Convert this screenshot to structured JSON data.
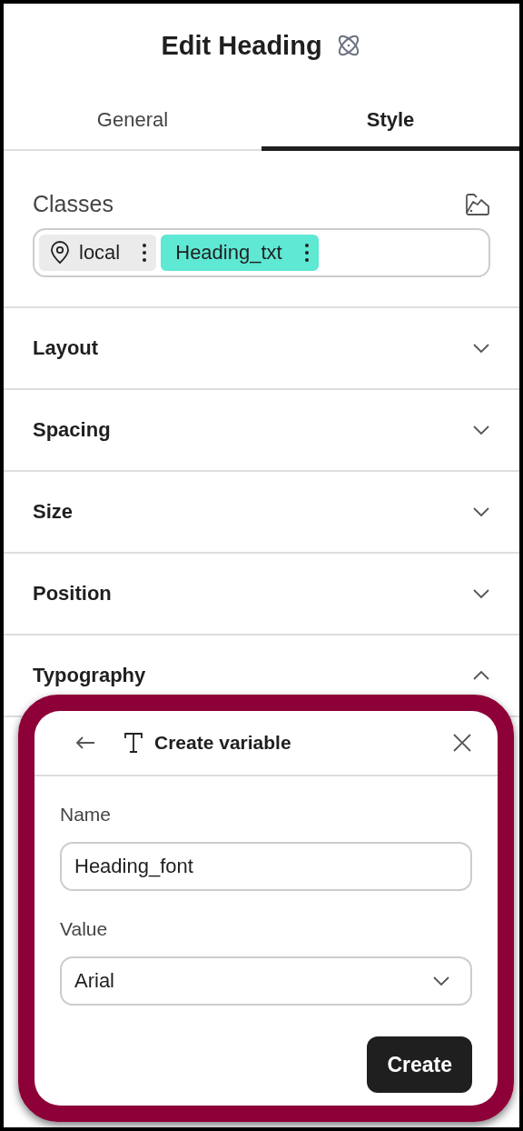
{
  "panel": {
    "title": "Edit Heading"
  },
  "tabs": [
    {
      "label": "General",
      "selected": false
    },
    {
      "label": "Style",
      "selected": true
    }
  ],
  "classes": {
    "label": "Classes",
    "chips": [
      {
        "kind": "local",
        "label": "local"
      },
      {
        "kind": "class",
        "label": "Heading_txt"
      }
    ]
  },
  "sections": [
    {
      "label": "Layout",
      "expanded": false
    },
    {
      "label": "Spacing",
      "expanded": false
    },
    {
      "label": "Size",
      "expanded": false
    },
    {
      "label": "Position",
      "expanded": false
    },
    {
      "label": "Typography",
      "expanded": true
    }
  ],
  "dialog": {
    "title": "Create variable",
    "name_label": "Name",
    "name_value": "Heading_font",
    "value_label": "Value",
    "value_value": "Arial",
    "button": "Create"
  }
}
